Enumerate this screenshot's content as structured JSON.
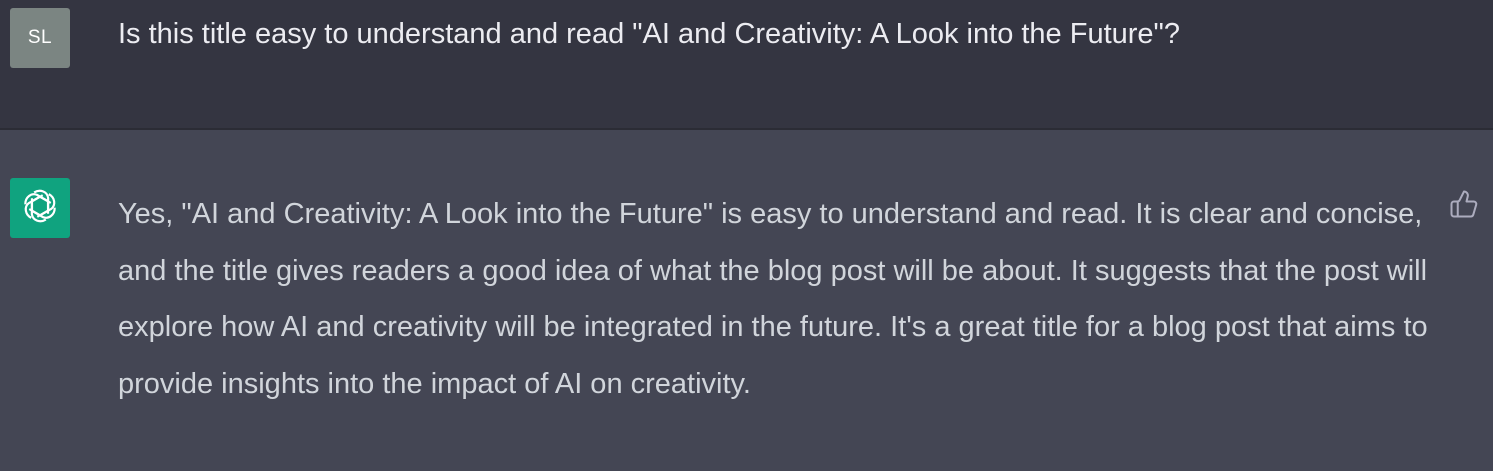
{
  "user_message": {
    "avatar_initials": "SL",
    "text": "Is this title easy to understand and read \"AI and Creativity: A Look into the Future\"?"
  },
  "assistant_message": {
    "avatar_icon": "openai-logo-icon",
    "text": "Yes, \"AI and Creativity: A Look into the Future\" is easy to understand and read. It is clear and concise, and the title gives readers a good idea of what the blog post will be about. It suggests that the post will explore how AI and creativity will be integrated in the future. It's a great title for a blog post that aims to provide insights into the impact of AI on creativity.",
    "feedback_icon": "thumbs-up-icon"
  },
  "colors": {
    "user_bg": "#343541",
    "assistant_bg": "#444654",
    "user_avatar_bg": "#7b8582",
    "assistant_avatar_bg": "#10a37f",
    "text": "#d1d5db"
  }
}
